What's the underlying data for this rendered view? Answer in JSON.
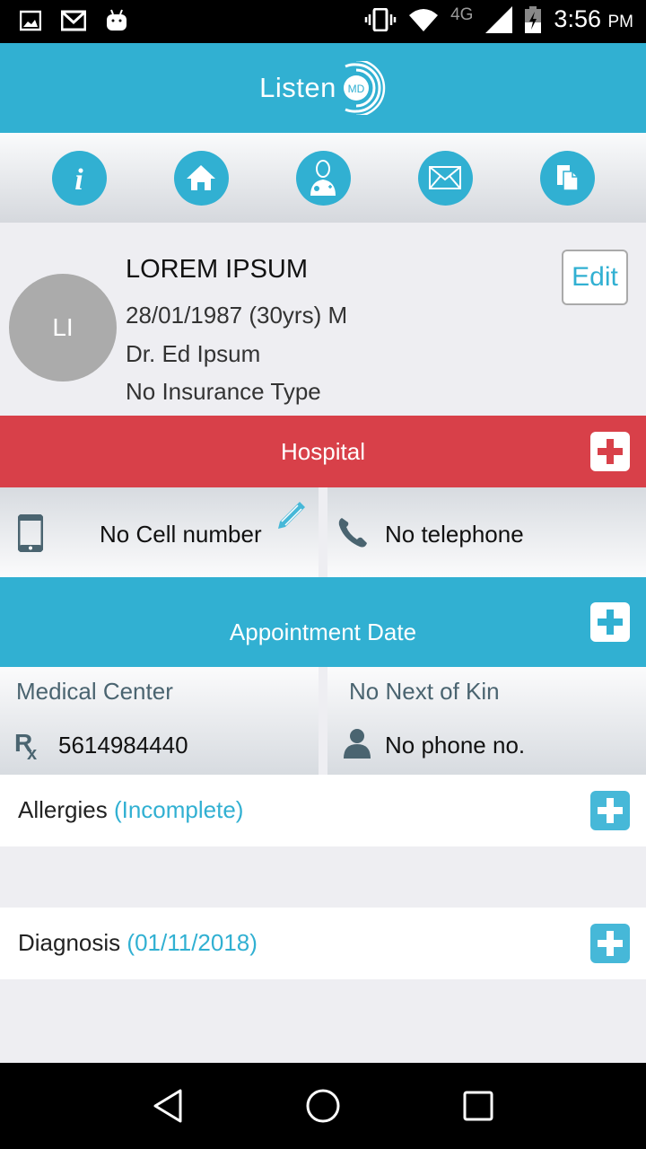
{
  "status_bar": {
    "time": "3:56",
    "ampm": "PM",
    "network": "4G",
    "left_icons": [
      "image-notification-icon",
      "gmail-icon",
      "android-icon"
    ],
    "right_icons": [
      "vibrate-icon",
      "wifi-icon",
      "signal-icon",
      "battery-charging-icon"
    ]
  },
  "app": {
    "logo_text": "Listen",
    "logo_badge": "MD",
    "brand_color": "#31b0d2"
  },
  "toolbar": {
    "buttons": [
      {
        "icon": "info-icon",
        "name": "info-button"
      },
      {
        "icon": "home-icon",
        "name": "home-button"
      },
      {
        "icon": "doctor-icon",
        "name": "doctor-button"
      },
      {
        "icon": "mail-icon",
        "name": "mail-button"
      },
      {
        "icon": "documents-icon",
        "name": "documents-button"
      }
    ]
  },
  "profile": {
    "initials": "LI",
    "name": "LOREM IPSUM",
    "dob_line": "28/01/1987 (30yrs) M",
    "doctor": "Dr. Ed Ipsum",
    "insurance": "No Insurance Type",
    "edit_label": "Edit"
  },
  "hospital": {
    "title": "Hospital",
    "color": "#d84049"
  },
  "contact": {
    "cell": "No Cell number",
    "telephone": "No telephone"
  },
  "appointment": {
    "title": "Appointment Date"
  },
  "medical_center": {
    "label": "Medical Center",
    "phone": "5614984440"
  },
  "next_of_kin": {
    "label": "No Next of Kin",
    "phone": "No phone no."
  },
  "allergies": {
    "label": "Allergies",
    "status": "(Incomplete)"
  },
  "diagnosis": {
    "label": "Diagnosis",
    "date": "(01/11/2018)"
  },
  "navigation": [
    "back",
    "home",
    "recents"
  ]
}
